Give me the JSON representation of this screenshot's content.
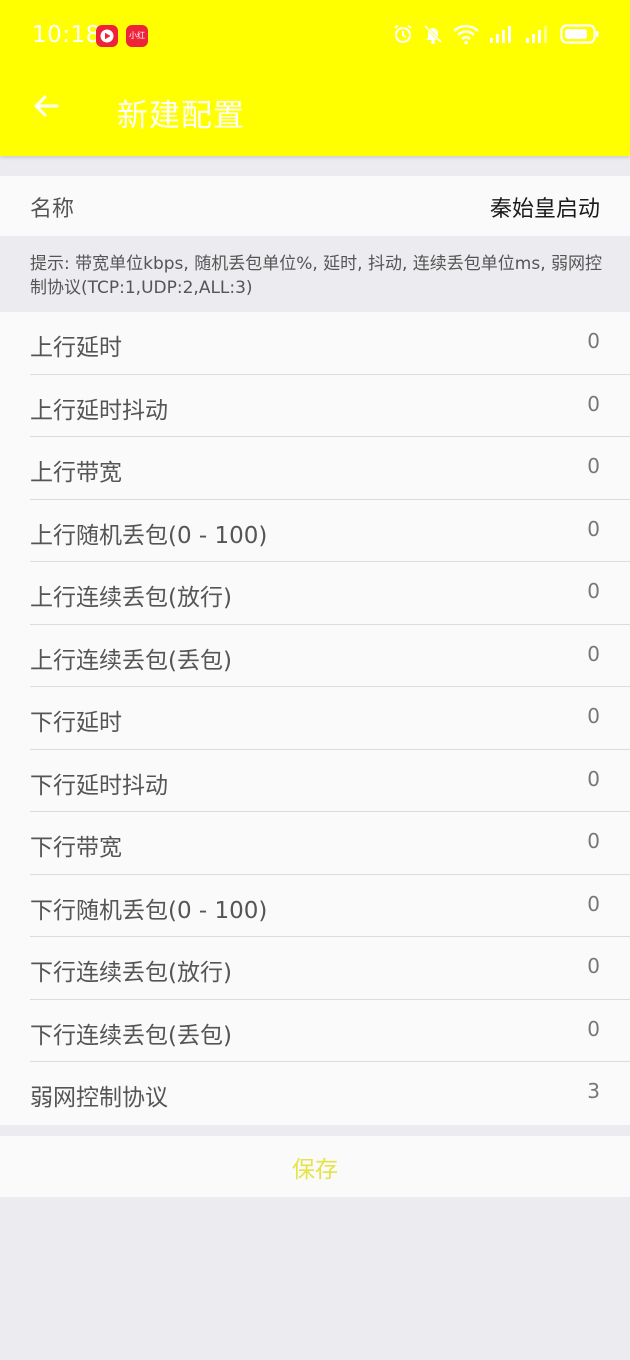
{
  "status_bar": {
    "time": "10:18",
    "badge_2_label": "小红书",
    "icons": [
      "video-app-icon",
      "xiaohongshu-app-icon",
      "alarm-icon",
      "mute-bell-icon",
      "wifi-icon",
      "signal-icon",
      "signal-icon",
      "battery-icon"
    ]
  },
  "header": {
    "title": "新建配置",
    "back_icon": "arrow-left-icon",
    "bg_color": "#ffff00"
  },
  "name_row": {
    "label": "名称",
    "value": "秦始皇启动"
  },
  "hint": "提示: 带宽单位kbps, 随机丢包单位%, 延时, 抖动, 连续丢包单位ms, 弱网控制协议(TCP:1,UDP:2,ALL:3)",
  "settings": [
    {
      "label": "上行延时",
      "value": "0"
    },
    {
      "label": "上行延时抖动",
      "value": "0"
    },
    {
      "label": "上行带宽",
      "value": "0"
    },
    {
      "label": "上行随机丢包(0 - 100)",
      "value": "0"
    },
    {
      "label": "上行连续丢包(放行)",
      "value": "0"
    },
    {
      "label": "上行连续丢包(丢包)",
      "value": "0"
    },
    {
      "label": "下行延时",
      "value": "0"
    },
    {
      "label": "下行延时抖动",
      "value": "0"
    },
    {
      "label": "下行带宽",
      "value": "0"
    },
    {
      "label": "下行随机丢包(0 - 100)",
      "value": "0"
    },
    {
      "label": "下行连续丢包(放行)",
      "value": "0"
    },
    {
      "label": "下行连续丢包(丢包)",
      "value": "0"
    },
    {
      "label": "弱网控制协议",
      "value": "3"
    }
  ],
  "save_label": "保存"
}
